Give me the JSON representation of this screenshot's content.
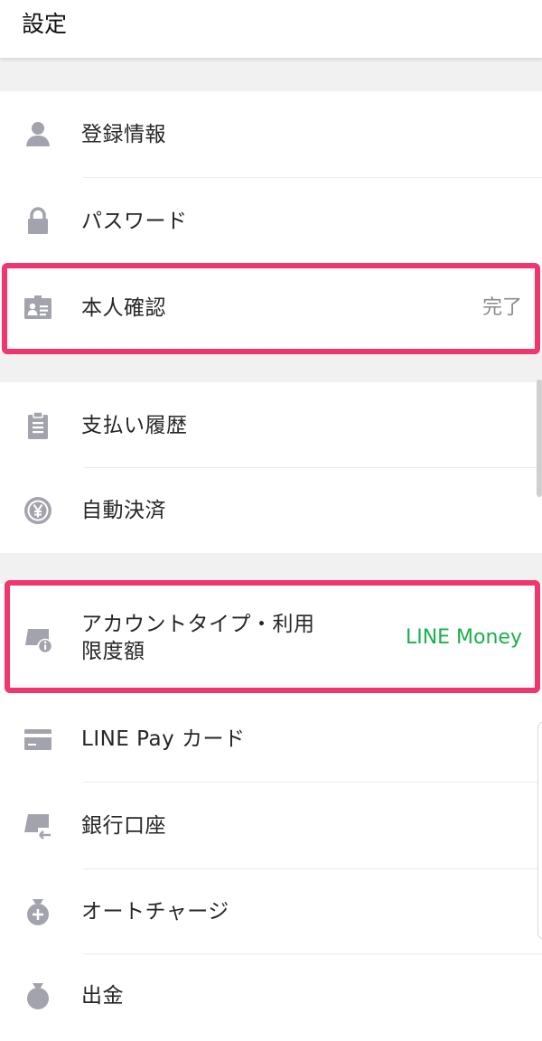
{
  "header": {
    "title": "設定"
  },
  "items": {
    "registration": {
      "label": "登録情報",
      "icon": "person-icon"
    },
    "password": {
      "label": "パスワード",
      "icon": "lock-icon"
    },
    "identity": {
      "label": "本人確認",
      "icon": "id-card-icon",
      "value": "完了"
    },
    "payment_history": {
      "label": "支払い履歴",
      "icon": "clipboard-icon"
    },
    "auto_pay": {
      "label": "自動決済",
      "icon": "yen-coin-icon"
    },
    "account_type": {
      "label": "アカウントタイプ・利用\n限度額",
      "icon": "account-info-icon",
      "value": "LINE Money"
    },
    "linepay_card": {
      "label": "LINE Pay カード",
      "icon": "card-icon"
    },
    "bank_account": {
      "label": "銀行口座",
      "icon": "bank-transfer-icon"
    },
    "auto_charge": {
      "label": "オートチャージ",
      "icon": "money-bag-plus-icon"
    },
    "withdraw": {
      "label": "出金",
      "icon": "money-bag-icon"
    }
  },
  "colors": {
    "highlight": "#f0366d",
    "accent_green": "#1bb04b",
    "icon_gray": "#a3a3ad"
  }
}
